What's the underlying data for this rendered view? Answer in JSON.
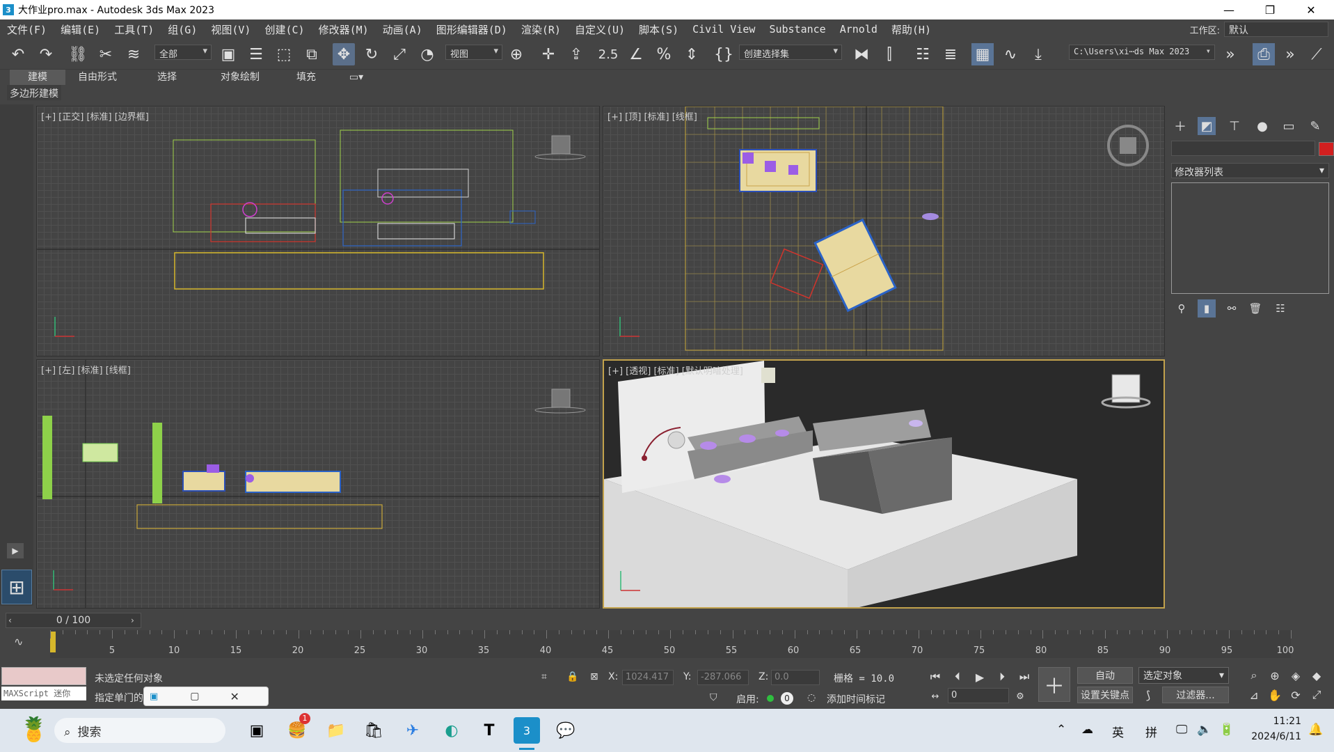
{
  "window": {
    "title": "大作业pro.max - Autodesk 3ds Max 2023",
    "app_icon": "3",
    "minimize": "—",
    "maximize": "❐",
    "close": "✕"
  },
  "menu": [
    "文件(F)",
    "编辑(E)",
    "工具(T)",
    "组(G)",
    "视图(V)",
    "创建(C)",
    "修改器(M)",
    "动画(A)",
    "图形编辑器(D)",
    "渲染(R)",
    "自定义(U)",
    "脚本(S)",
    "Civil View",
    "Substance",
    "Arnold",
    "帮助(H)"
  ],
  "workspace": {
    "label": "工作区:",
    "value": "默认"
  },
  "toolbar": {
    "filter": "全部",
    "ref_coord": "视图",
    "selection_set": "创建选择集",
    "snap_label": "2.5",
    "project_path": "C:\\Users\\xi⋯ds Max 2023"
  },
  "ribbon": {
    "tabs": [
      "建模",
      "自由形式",
      "选择",
      "对象绘制",
      "填充"
    ],
    "active": "建模",
    "subtab": "多边形建模"
  },
  "viewports": {
    "front": "[+] [正交] [标准] [边界框]",
    "top": "[+] [顶] [标准] [线框]",
    "left": "[+] [左] [标准] [线框]",
    "perspective": "[+] [透视] [标准] [默认明暗处理]"
  },
  "command_panel": {
    "modifier_list": "修改器列表"
  },
  "timeline": {
    "slider": "0 / 100",
    "labels": [
      "5",
      "10",
      "15",
      "20",
      "25",
      "30",
      "35",
      "40",
      "45",
      "50",
      "55",
      "60",
      "65",
      "70",
      "75",
      "80",
      "85",
      "90",
      "95",
      "100"
    ]
  },
  "status": {
    "maxscript": "MAXScript 迷你",
    "line1": "未选定任何对象",
    "line2": "指定单门的",
    "x_label": "X:",
    "x": "1024.417",
    "y_label": "Y:",
    "y": "-287.066",
    "z_label": "Z:",
    "z": "0.0",
    "grid": "栅格 = 10.0",
    "enabled_label": "启用:",
    "enabled_value": "0",
    "add_time_tag": "添加时间标记",
    "auto": "自动",
    "selected_object": "选定对象",
    "set_key": "设置关键点",
    "filters": "过滤器...",
    "frame": "0"
  },
  "taskbar": {
    "search": "搜索",
    "badge": "1",
    "ime1": "英",
    "ime2": "拼",
    "time": "11:21",
    "date": "2024/6/11"
  }
}
